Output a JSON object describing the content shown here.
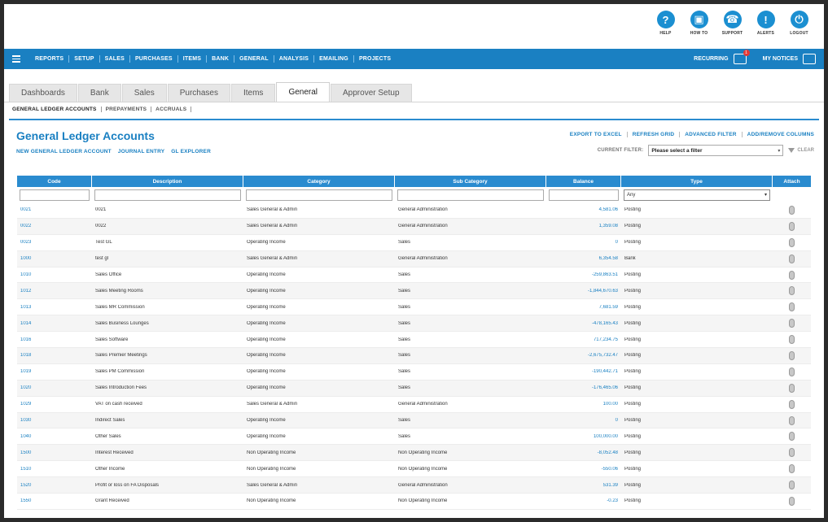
{
  "top_icons": [
    {
      "label": "HELP",
      "icon": "help-icon",
      "glyph": "?"
    },
    {
      "label": "HOW TO",
      "icon": "howto-icon",
      "glyph": "▣"
    },
    {
      "label": "SUPPORT",
      "icon": "support-icon",
      "glyph": "☎"
    },
    {
      "label": "ALERTS",
      "icon": "alerts-icon",
      "glyph": "!"
    },
    {
      "label": "LOGOUT",
      "icon": "power-icon",
      "glyph": "⏻"
    }
  ],
  "nav": {
    "items": [
      "REPORTS",
      "SETUP",
      "SALES",
      "PURCHASES",
      "ITEMS",
      "BANK",
      "GENERAL",
      "ANALYSIS",
      "EMAILING",
      "PROJECTS"
    ],
    "recurring": "RECURRING",
    "recurring_badge": "1",
    "notices": "MY NOTICES"
  },
  "tabs": [
    "Dashboards",
    "Bank",
    "Sales",
    "Purchases",
    "Items",
    "General",
    "Approver Setup"
  ],
  "active_tab": "General",
  "subtabs": [
    "GENERAL LEDGER ACCOUNTS",
    "PREPAYMENTS",
    "ACCRUALS"
  ],
  "page": {
    "title": "General Ledger Accounts",
    "action_links": [
      "NEW GENERAL LEDGER ACCOUNT",
      "JOURNAL ENTRY",
      "GL EXPLORER"
    ],
    "right_links": [
      "EXPORT TO EXCEL",
      "REFRESH GRID",
      "ADVANCED FILTER",
      "ADD/REMOVE COLUMNS"
    ],
    "filter_label": "CURRENT FILTER:",
    "filter_value": "Please select a filter",
    "clear_label": "CLEAR"
  },
  "grid": {
    "columns": [
      "Code",
      "Description",
      "Category",
      "Sub Category",
      "Balance",
      "Type",
      "Attach"
    ],
    "type_filter": "Any",
    "rows": [
      [
        "0021",
        "0021",
        "Sales General & Admin",
        "General Administration",
        "4,581.06",
        "Posting"
      ],
      [
        "0022",
        "0022",
        "Sales General & Admin",
        "General Administration",
        "1,359.08",
        "Posting"
      ],
      [
        "0023",
        "Test GL",
        "Operating Income",
        "Sales",
        "0",
        "Posting"
      ],
      [
        "1000",
        "test gl",
        "Sales General & Admin",
        "General Administration",
        "6,354.58",
        "Bank"
      ],
      [
        "1010",
        "Sales Office",
        "Operating Income",
        "Sales",
        "-259,863.51",
        "Posting"
      ],
      [
        "1012",
        "Sales Meeting Rooms",
        "Operating Income",
        "Sales",
        "-1,844,670.63",
        "Posting"
      ],
      [
        "1013",
        "Sales MR Commission",
        "Operating Income",
        "Sales",
        "7,681.59",
        "Posting"
      ],
      [
        "1014",
        "Sales Business Lounges",
        "Operating Income",
        "Sales",
        "-478,165.43",
        "Posting"
      ],
      [
        "1016",
        "Sales Software",
        "Operating Income",
        "Sales",
        "717,234.75",
        "Posting"
      ],
      [
        "1018",
        "Sales Premier Meetings",
        "Operating Income",
        "Sales",
        "-2,675,732.47",
        "Posting"
      ],
      [
        "1019",
        "Sales PM Commission",
        "Operating Income",
        "Sales",
        "-190,442.71",
        "Posting"
      ],
      [
        "1020",
        "Sales Introduction Fees",
        "Operating Income",
        "Sales",
        "-176,465.06",
        "Posting"
      ],
      [
        "1029",
        "VAT on cash received",
        "Sales General & Admin",
        "General Administration",
        "100.00",
        "Posting"
      ],
      [
        "1030",
        "Indirect Sales",
        "Operating Income",
        "Sales",
        "0",
        "Posting"
      ],
      [
        "1040",
        "Other Sales",
        "Operating Income",
        "Sales",
        "100,000.00",
        "Posting"
      ],
      [
        "1500",
        "Interest Received",
        "Non Operating Income",
        "Non Operating Income",
        "-8,052.48",
        "Posting"
      ],
      [
        "1510",
        "Other Income",
        "Non Operating Income",
        "Non Operating Income",
        "-550.06",
        "Posting"
      ],
      [
        "1520",
        "Profit or loss on FA Disposals",
        "Sales General & Admin",
        "General Administration",
        "531.39",
        "Posting"
      ],
      [
        "1550",
        "Grant Received",
        "Non Operating Income",
        "Non Operating Income",
        "-0.23",
        "Posting"
      ]
    ]
  },
  "colors": {
    "accent": "#1a80c2",
    "header": "#2a8bcf"
  }
}
